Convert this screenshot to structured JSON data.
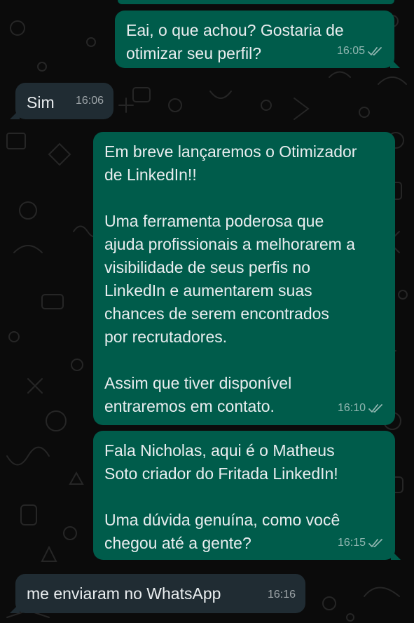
{
  "messages": [
    {
      "direction": "outgoing",
      "text": "Eai, o que achou? Gostaria de\notimizar seu perfil?",
      "time": "16:05",
      "status_icon": "read-double-check-icon"
    },
    {
      "direction": "incoming",
      "text": "Sim",
      "time": "16:06"
    },
    {
      "direction": "outgoing",
      "text": "Em breve lançaremos o Otimizador\nde LinkedIn!!\n\nUma ferramenta poderosa que\najuda profissionais a melhorarem a\nvisibilidade de seus perfis no\nLinkedIn e aumentarem suas\nchances de serem encontrados\npor recrutadores.\n\nAssim que tiver disponível\nentraremos em contato.",
      "time": "16:10",
      "status_icon": "read-double-check-icon"
    },
    {
      "direction": "outgoing",
      "text": "Fala Nicholas, aqui é o Matheus\nSoto criador do Fritada LinkedIn!\n\nUma dúvida genuína, como você\nchegou até a gente?",
      "time": "16:15",
      "status_icon": "read-double-check-icon"
    },
    {
      "direction": "incoming",
      "text": "me enviaram no WhatsApp",
      "time": "16:16"
    }
  ],
  "colors": {
    "outgoing_bubble": "#005c4b",
    "incoming_bubble": "#202c33",
    "background": "#0b0b0b",
    "text": "#e9edef"
  }
}
